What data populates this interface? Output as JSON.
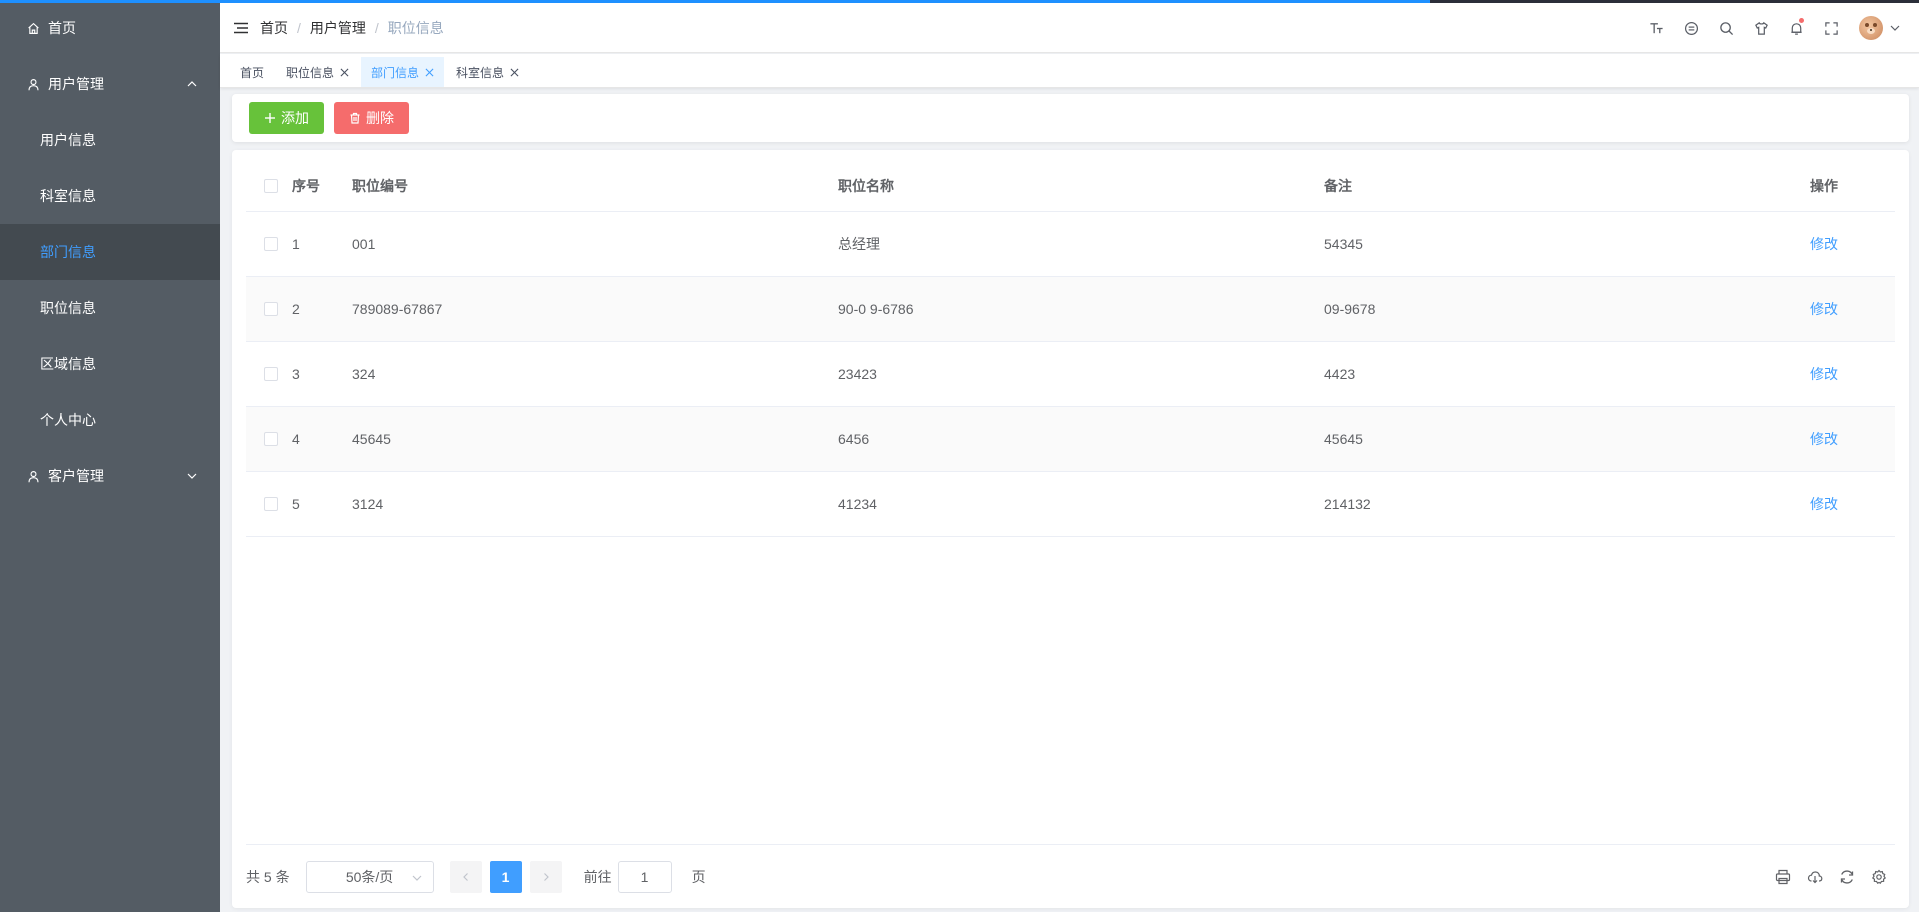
{
  "sidebar": {
    "home": "首页",
    "user_mgmt": {
      "label": "用户管理",
      "items": [
        {
          "label": "用户信息",
          "active": false
        },
        {
          "label": "科室信息",
          "active": false
        },
        {
          "label": "部门信息",
          "active": true
        },
        {
          "label": "职位信息",
          "active": false
        },
        {
          "label": "区域信息",
          "active": false
        },
        {
          "label": "个人中心",
          "active": false
        }
      ]
    },
    "customer_mgmt": "客户管理"
  },
  "header": {
    "breadcrumb": [
      "首页",
      "用户管理",
      "职位信息"
    ],
    "separator": "/",
    "icons": [
      "font-size-icon",
      "theme-icon",
      "search-icon",
      "skin-icon",
      "bell-icon",
      "fullscreen-icon"
    ]
  },
  "tags": [
    {
      "label": "首页",
      "closable": false,
      "active": false
    },
    {
      "label": "职位信息",
      "closable": true,
      "active": false
    },
    {
      "label": "部门信息",
      "closable": true,
      "active": true
    },
    {
      "label": "科室信息",
      "closable": true,
      "active": false
    }
  ],
  "toolbar": {
    "add_label": "添加",
    "delete_label": "删除"
  },
  "table": {
    "columns": [
      "序号",
      "职位编号",
      "职位名称",
      "备注",
      "操作"
    ],
    "rows": [
      {
        "idx": "1",
        "code": "001",
        "name": "总经理",
        "remark": "54345",
        "action": "修改"
      },
      {
        "idx": "2",
        "code": "789089-67867",
        "name": "90-0 9-6786",
        "remark": "09-9678",
        "action": "修改"
      },
      {
        "idx": "3",
        "code": "324",
        "name": "23423",
        "remark": "4423",
        "action": "修改"
      },
      {
        "idx": "4",
        "code": "45645",
        "name": "6456",
        "remark": "45645",
        "action": "修改"
      },
      {
        "idx": "5",
        "code": "3124",
        "name": "41234",
        "remark": "214132",
        "action": "修改"
      }
    ]
  },
  "pagination": {
    "total_text": "共 5 条",
    "page_size": "50条/页",
    "current_page": "1",
    "goto_label": "前往",
    "goto_value": "1",
    "page_unit": "页"
  },
  "colors": {
    "sidebar_bg": "#545c64",
    "accent": "#409eff",
    "add_button": "#67c23a",
    "delete_button": "#f56c6c"
  }
}
